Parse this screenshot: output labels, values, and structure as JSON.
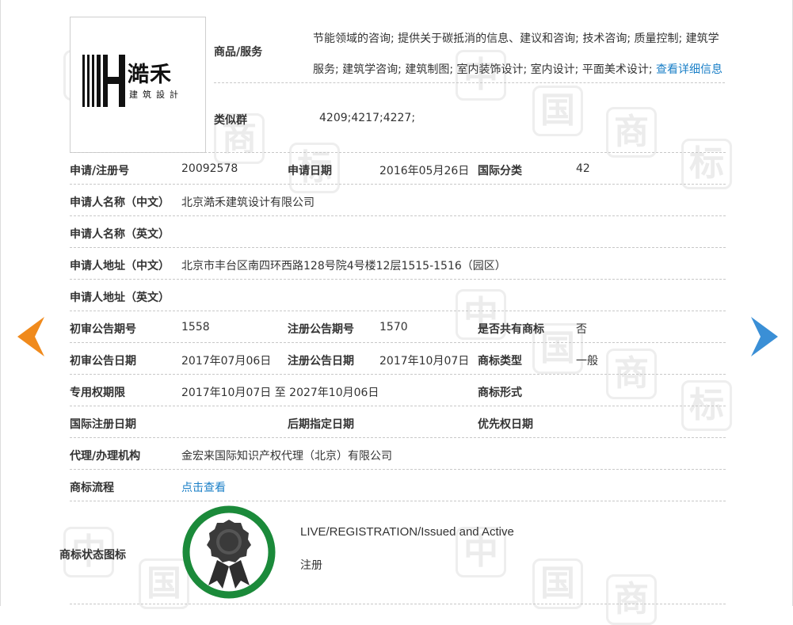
{
  "watermark": {
    "glyph_a": "中",
    "glyph_b": "国",
    "glyph_c": "商",
    "glyph_d": "标"
  },
  "logo": {
    "chinese": "澔禾",
    "subtitle": "建筑設計"
  },
  "goods_services": {
    "label": "商品/服务",
    "text": "节能领域的咨询; 提供关于碳抵消的信息、建议和咨询; 技术咨询; 质量控制; 建筑学服务; 建筑学咨询; 建筑制图; 室内装饰设计; 室内设计; 平面美术设计; ",
    "detail_link": "查看详细信息"
  },
  "similar_group": {
    "label": "类似群",
    "value": "4209;4217;4227;"
  },
  "rows": {
    "reg_no": {
      "label": "申请/注册号",
      "value": "20092578"
    },
    "app_date": {
      "label": "申请日期",
      "value": "2016年05月26日"
    },
    "intl_class": {
      "label": "国际分类",
      "value": "42"
    },
    "applicant_cn": {
      "label": "申请人名称（中文）",
      "value": "北京澔禾建筑设计有限公司"
    },
    "applicant_en": {
      "label": "申请人名称（英文）",
      "value": ""
    },
    "address_cn": {
      "label": "申请人地址（中文）",
      "value": "北京市丰台区南四环西路128号院4号楼12层1515-1516（园区）"
    },
    "address_en": {
      "label": "申请人地址（英文）",
      "value": ""
    },
    "prelim_no": {
      "label": "初审公告期号",
      "value": "1558"
    },
    "reg_ann_no": {
      "label": "注册公告期号",
      "value": "1570"
    },
    "shared": {
      "label": "是否共有商标",
      "value": "否"
    },
    "prelim_date": {
      "label": "初审公告日期",
      "value": "2017年07月06日"
    },
    "reg_ann_date": {
      "label": "注册公告日期",
      "value": "2017年10月07日"
    },
    "tm_type": {
      "label": "商标类型",
      "value": "一般"
    },
    "exclusive": {
      "label": "专用权期限",
      "value": "2017年10月07日 至 2027年10月06日"
    },
    "tm_form": {
      "label": "商标形式",
      "value": ""
    },
    "intl_reg_date": {
      "label": "国际注册日期",
      "value": ""
    },
    "later_date": {
      "label": "后期指定日期",
      "value": ""
    },
    "priority_date": {
      "label": "优先权日期",
      "value": ""
    },
    "agent": {
      "label": "代理/办理机构",
      "value": "金宏来国际知识产权代理（北京）有限公司"
    },
    "process": {
      "label": "商标流程",
      "value": "点击查看"
    }
  },
  "status": {
    "label": "商标状态图标",
    "english": "LIVE/REGISTRATION/Issued and Active",
    "chinese": "注册"
  },
  "colors": {
    "link": "#1a7fc7",
    "left_arrow": "#f08a1c",
    "right_arrow": "#3a8fd6",
    "status_ring": "#1b8a3a"
  },
  "icons": {
    "prev": "left-arrow-icon",
    "next": "right-arrow-icon",
    "status": "award-ribbon-icon"
  }
}
